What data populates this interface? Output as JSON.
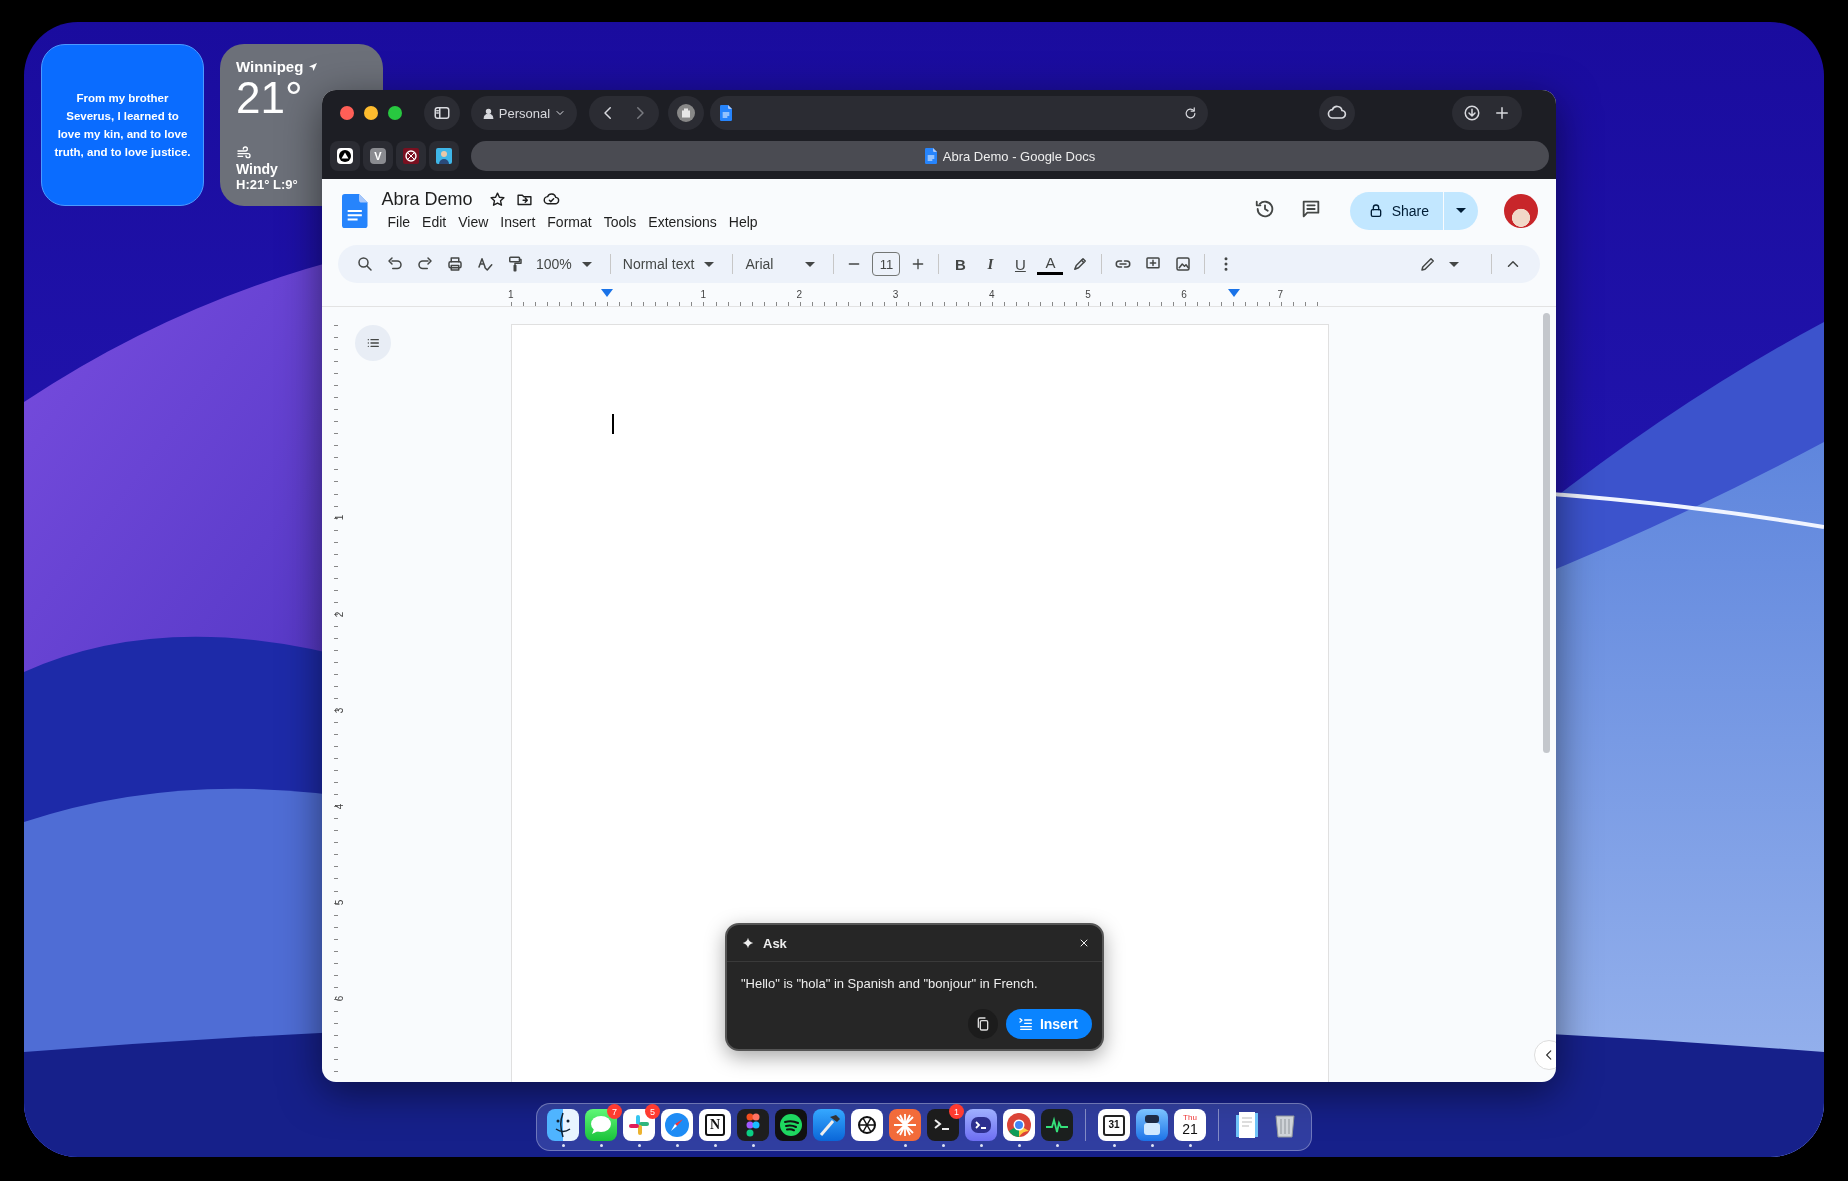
{
  "widgets": {
    "quote": {
      "text": "From my brother Severus, I learned to love my kin, and to love truth, and to love justice."
    },
    "weather": {
      "city": "Winnipeg",
      "temperature": "21°",
      "condition": "Windy",
      "range": "H:21° L:9°"
    }
  },
  "browser": {
    "profile": "Personal",
    "pinned_tabs": [
      {
        "kind": "triangle"
      },
      {
        "kind": "letter",
        "glyph": "V"
      },
      {
        "kind": "target"
      },
      {
        "kind": "person"
      }
    ],
    "tab_title": "Abra Demo - Google Docs"
  },
  "docs": {
    "title": "Abra Demo",
    "menu": [
      "File",
      "Edit",
      "View",
      "Insert",
      "Format",
      "Tools",
      "Extensions",
      "Help"
    ],
    "share": "Share",
    "toolbar": {
      "zoom": "100%",
      "style": "Normal text",
      "font": "Arial",
      "font_size": "11",
      "format": [
        {
          "kind": "bold",
          "glyph": "B"
        },
        {
          "kind": "italic",
          "glyph": "I"
        },
        {
          "kind": "underline",
          "glyph": "U"
        },
        {
          "kind": "color",
          "glyph": "A"
        }
      ]
    },
    "ruler": {
      "horizontal": [
        "1",
        "1",
        "2",
        "3",
        "4",
        "5",
        "6",
        "7"
      ],
      "vertical": [
        "1",
        "2",
        "3",
        "4",
        "5",
        "6"
      ]
    }
  },
  "ask": {
    "title": "Ask",
    "answer": "\"Hello\" is \"hola\" in Spanish and \"bonjour\" in French.",
    "insert": "Insert"
  },
  "dock": [
    [
      {
        "kind": "finder",
        "running": true
      },
      {
        "kind": "messages",
        "running": true,
        "badge": "7"
      },
      {
        "kind": "slack",
        "running": true,
        "badge": "5"
      },
      {
        "kind": "safari",
        "running": true
      },
      {
        "kind": "notion",
        "running": true,
        "glyph": "N"
      },
      {
        "kind": "figma",
        "running": true
      },
      {
        "kind": "spotify",
        "running": false
      },
      {
        "kind": "xcode",
        "running": false
      },
      {
        "kind": "chatgpt",
        "running": false
      },
      {
        "kind": "claude",
        "running": true
      },
      {
        "kind": "terminal",
        "running": true,
        "badge": "1"
      },
      {
        "kind": "warp",
        "running": true
      },
      {
        "kind": "chrome",
        "running": true
      },
      {
        "kind": "activity",
        "running": true
      }
    ],
    [
      {
        "kind": "calendar31",
        "running": true,
        "glyph": "31"
      },
      {
        "kind": "preview",
        "running": true
      },
      {
        "kind": "calendar",
        "running": true,
        "caption": "Thu",
        "glyph": "21"
      }
    ],
    [
      {
        "kind": "document",
        "running": false
      },
      {
        "kind": "trash",
        "running": false
      }
    ]
  ]
}
